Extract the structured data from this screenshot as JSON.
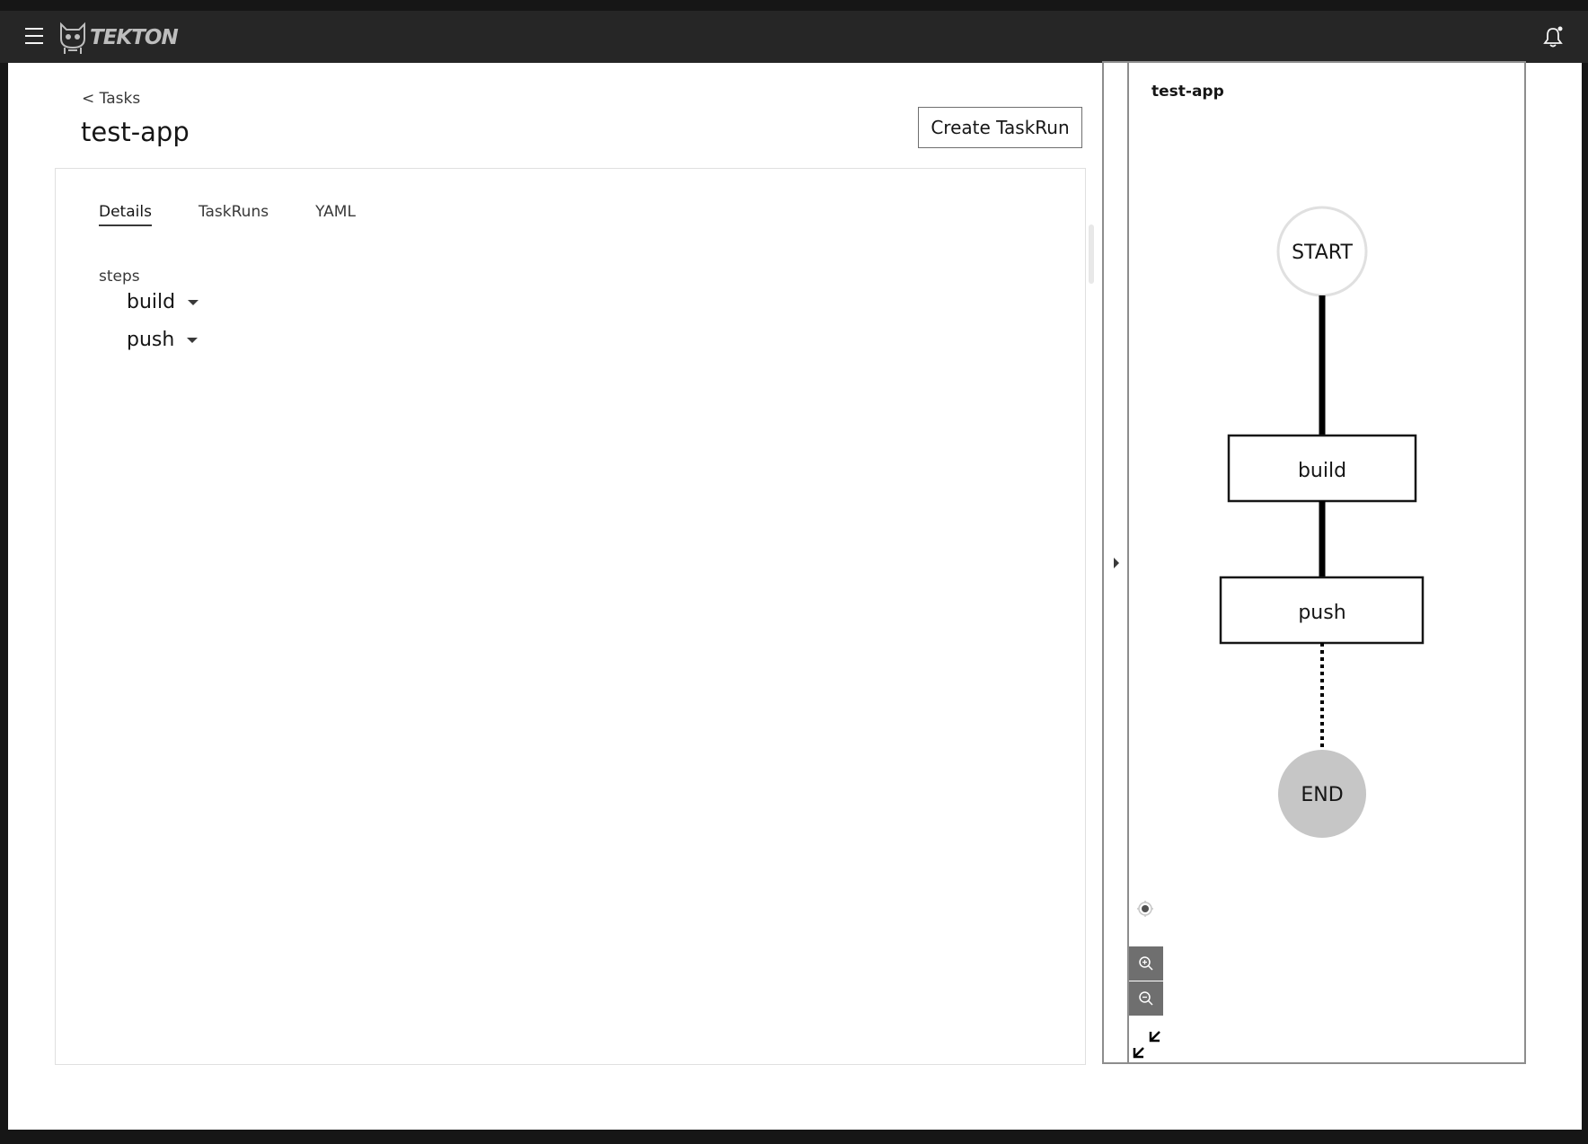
{
  "header": {
    "logo_text": "TEKTON"
  },
  "breadcrumb": "< Tasks",
  "page": {
    "title": "test-app",
    "create_button": "Create TaskRun"
  },
  "tabs": [
    {
      "label": "Details",
      "active": true
    },
    {
      "label": "TaskRuns",
      "active": false
    },
    {
      "label": "YAML",
      "active": false
    }
  ],
  "details": {
    "steps_label": "steps",
    "steps": [
      "build",
      "push"
    ]
  },
  "sidebar": {
    "title": "test-app",
    "graph": {
      "start_label": "START",
      "nodes": [
        "build",
        "push"
      ],
      "end_label": "END"
    }
  }
}
